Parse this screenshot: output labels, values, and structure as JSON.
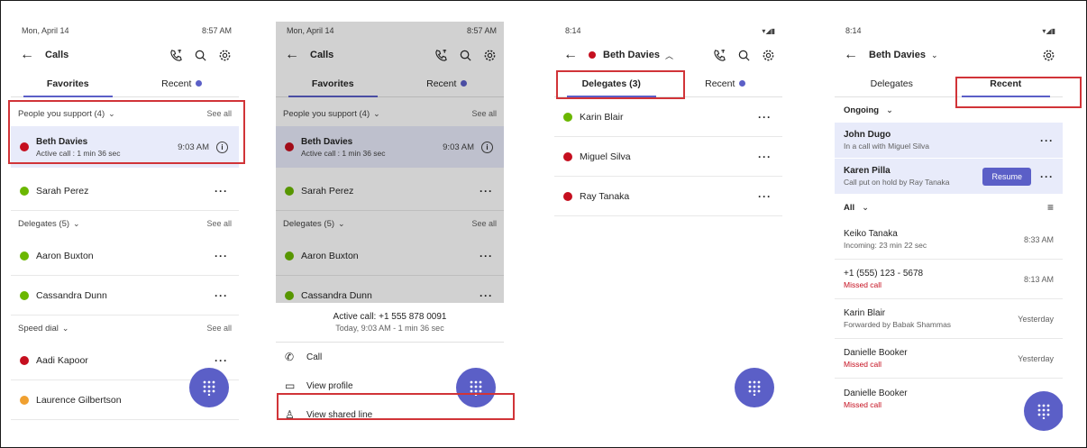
{
  "p1": {
    "status": {
      "date": "Mon, April 14",
      "time": "8:57 AM"
    },
    "title": "Calls",
    "tabs": {
      "favorites": "Favorites",
      "recent": "Recent"
    },
    "support_section": {
      "label": "People you support (4)",
      "see_all": "See all"
    },
    "active": {
      "name": "Beth Davies",
      "sub": "Active call : 1 min 36 sec",
      "time": "9:03 AM"
    },
    "sarah": "Sarah Perez",
    "delegates_section": {
      "label": "Delegates (5)",
      "see_all": "See all"
    },
    "aaron": "Aaron Buxton",
    "cassandra": "Cassandra Dunn",
    "speed_section": {
      "label": "Speed dial",
      "see_all": "See all"
    },
    "aadi": "Aadi Kapoor",
    "laurence": "Laurence Gilbertson"
  },
  "p2": {
    "sheet_title": "Active call: +1 555 878 0091",
    "sheet_sub": "Today, 9:03 AM - 1 min 36 sec",
    "actions": {
      "call": "Call",
      "profile": "View profile",
      "shared": "View shared line"
    }
  },
  "p3": {
    "status": {
      "time": "8:14"
    },
    "title": "Beth Davies",
    "tabs": {
      "delegates": "Delegates (3)",
      "recent": "Recent"
    },
    "rows": [
      "Karin Blair",
      "Miguel Silva",
      "Ray Tanaka"
    ]
  },
  "p4": {
    "status": {
      "time": "8:14"
    },
    "title": "Beth Davies",
    "tabs": {
      "delegates": "Delegates",
      "recent": "Recent"
    },
    "ongoing": "Ongoing",
    "john": {
      "name": "John Dugo",
      "sub": "In a call with Miguel Silva"
    },
    "karen": {
      "name": "Karen Pilla",
      "sub": "Call put on hold by Ray Tanaka",
      "resume": "Resume"
    },
    "filter": "All",
    "recent": [
      {
        "name": "Keiko Tanaka",
        "sub": "Incoming: 23 min 22 sec",
        "time": "8:33 AM"
      },
      {
        "name": "+1 (555) 123 - 5678",
        "sub": "Missed call",
        "time": "8:13 AM"
      },
      {
        "name": "Karin Blair",
        "sub": "Forwarded by Babak Shammas",
        "time": "Yesterday"
      },
      {
        "name": "Danielle Booker",
        "sub": "Missed call",
        "time": "Yesterday"
      },
      {
        "name": "Danielle Booker",
        "sub": "Missed call",
        "time": ""
      }
    ]
  },
  "colors": {
    "accent": "#5b5fc7",
    "highlight": "#d13438",
    "available": "#6bb700",
    "busy": "#c50f1f",
    "away": "#f0a030"
  }
}
